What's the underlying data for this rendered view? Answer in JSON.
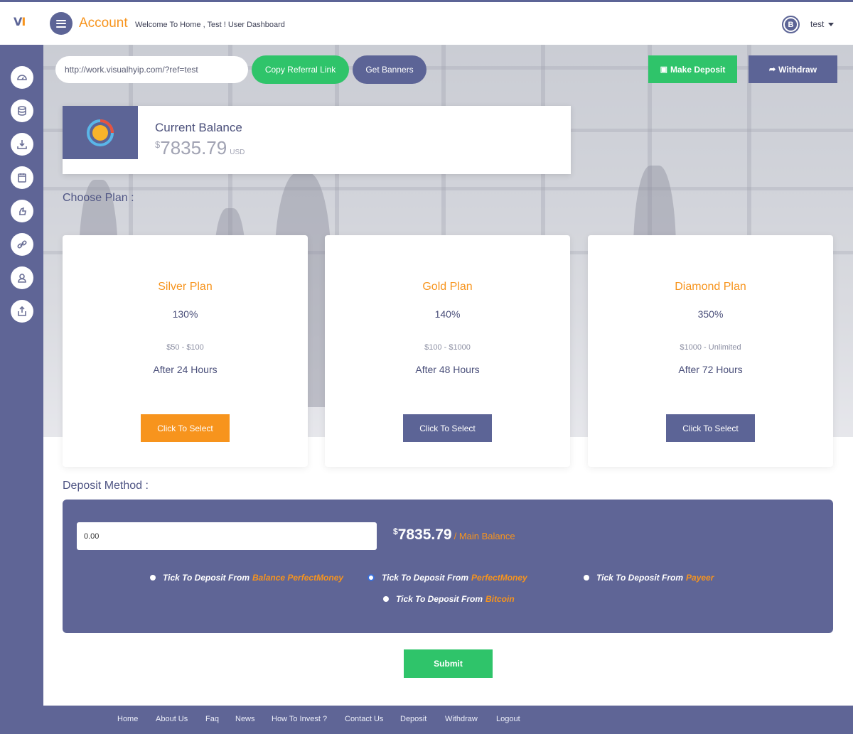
{
  "brand": {
    "logo_v": "V",
    "logo_i": "I",
    "accent": "#f7941d",
    "primary": "#5c6496",
    "success": "#2fc46a"
  },
  "header": {
    "title": "Account",
    "subtitle": "Welcome To Home , Test ! User Dashboard",
    "currency_icon": "B",
    "username": "test"
  },
  "sidebar": {
    "items": [
      {
        "icon": "dashboard-gauge-icon"
      },
      {
        "icon": "database-icon"
      },
      {
        "icon": "download-icon"
      },
      {
        "icon": "calendar-icon"
      },
      {
        "icon": "hand-icon"
      },
      {
        "icon": "link-icon"
      },
      {
        "icon": "user-icon"
      },
      {
        "icon": "share-icon"
      }
    ]
  },
  "referral": {
    "url": "http://work.visualhyip.com/?ref=test",
    "copy_label": "Copy Referral Link",
    "banners_label": "Get Banners"
  },
  "actions": {
    "deposit_label": "Make Deposit",
    "withdraw_label": "Withdraw"
  },
  "balance": {
    "label": "Current Balance",
    "currency_symbol": "$",
    "amount": "7835.79",
    "unit": "USD"
  },
  "plans_title": "Choose Plan :",
  "plans": [
    {
      "name": "Silver Plan",
      "percent": "130%",
      "range": "$50 - $100",
      "term": "After 24 Hours",
      "button": "Click To Select",
      "selected": true
    },
    {
      "name": "Gold Plan",
      "percent": "140%",
      "range": "$100 - $1000",
      "term": "After 48 Hours",
      "button": "Click To Select",
      "selected": false
    },
    {
      "name": "Diamond Plan",
      "percent": "350%",
      "range": "$1000 - Unlimited",
      "term": "After 72 Hours",
      "button": "Click To Select",
      "selected": false
    }
  ],
  "deposit": {
    "title": "Deposit Method :",
    "amount_value": "0.00",
    "main_balance_symbol": "$",
    "main_balance_amount": "7835.79",
    "main_balance_label": "/ Main Balance",
    "options": [
      {
        "prefix": "Tick To Deposit From",
        "source": "Balance PerfectMoney",
        "selected": false
      },
      {
        "prefix": "Tick To Deposit From",
        "source": "PerfectMoney",
        "selected": true
      },
      {
        "prefix": "Tick To Deposit From",
        "source": "Payeer",
        "selected": false
      },
      {
        "prefix": "Tick To Deposit From",
        "source": "Bitcoin",
        "selected": false
      }
    ],
    "submit_label": "Submit"
  },
  "footer": {
    "links": [
      "Home",
      "About Us",
      "Faq",
      "News",
      "How To Invest ?",
      "Contact Us",
      "Deposit",
      "Withdraw",
      "Logout"
    ]
  }
}
